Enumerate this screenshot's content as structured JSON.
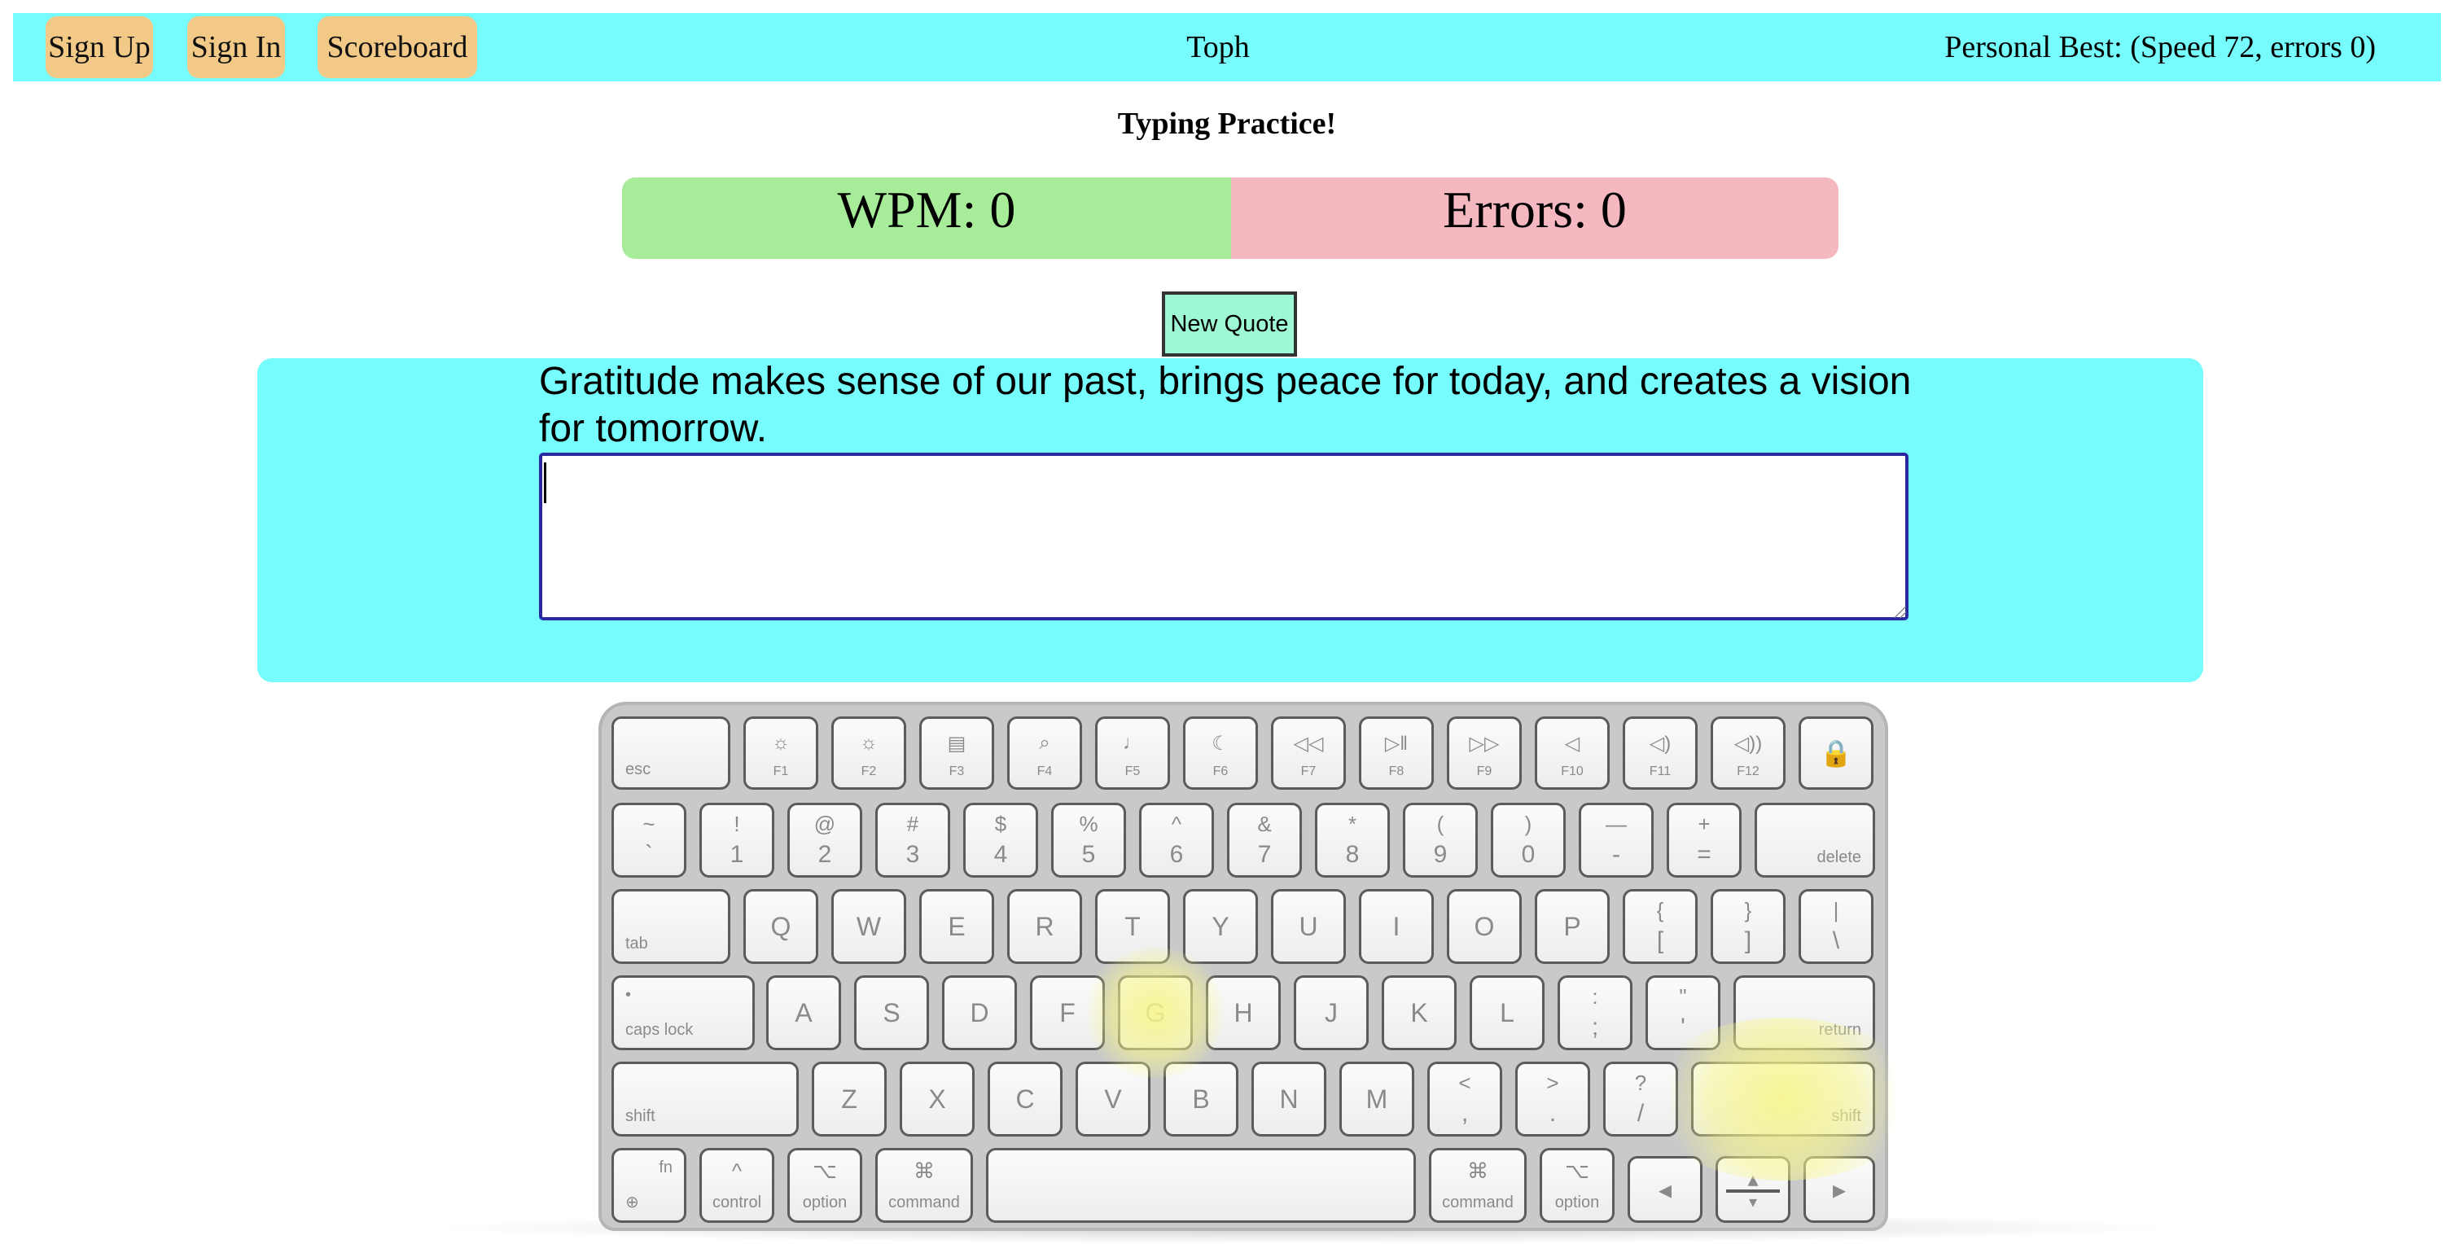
{
  "nav": {
    "signup_label": "Sign Up",
    "signin_label": "Sign In",
    "scoreboard_label": "Scoreboard",
    "brand": "Toph",
    "personal_best": "Personal Best: (Speed 72, errors 0)"
  },
  "main": {
    "title": "Typing Practice!",
    "wpm_text": "WPM: 0",
    "errors_text": "Errors: 0",
    "new_quote_label": "New Quote",
    "quote": "Gratitude makes sense of our past, brings peace for today, and creates a vision for tomorrow.",
    "input_value": ""
  },
  "colors": {
    "navbar": "#76fcfc",
    "nav_button": "#f2c987",
    "wpm_bg": "#a7ec98",
    "errors_bg": "#f5b8c0",
    "new_quote_bg": "#9ef7d5",
    "panel": "#76fcfc",
    "highlight": "#f6f68c"
  },
  "keyboard": {
    "highlighted_keys": [
      "G",
      "right shift"
    ],
    "fn_row": [
      {
        "icon": "☼",
        "label": "F1"
      },
      {
        "icon": "☼",
        "label": "F2"
      },
      {
        "icon": "▤",
        "label": "F3"
      },
      {
        "icon": "⌕",
        "label": "F4"
      },
      {
        "icon": "♩",
        "label": "F5"
      },
      {
        "icon": "☾",
        "label": "F6"
      },
      {
        "icon": "◁◁",
        "label": "F7"
      },
      {
        "icon": "▷‖",
        "label": "F8"
      },
      {
        "icon": "▷▷",
        "label": "F9"
      },
      {
        "icon": "◁",
        "label": "F10"
      },
      {
        "icon": "◁)",
        "label": "F11"
      },
      {
        "icon": "◁))",
        "label": "F12"
      }
    ],
    "esc": "esc",
    "lock_icon": "🔒",
    "number_row": [
      {
        "u": "~",
        "l": "`"
      },
      {
        "u": "!",
        "l": "1"
      },
      {
        "u": "@",
        "l": "2"
      },
      {
        "u": "#",
        "l": "3"
      },
      {
        "u": "$",
        "l": "4"
      },
      {
        "u": "%",
        "l": "5"
      },
      {
        "u": "^",
        "l": "6"
      },
      {
        "u": "&",
        "l": "7"
      },
      {
        "u": "*",
        "l": "8"
      },
      {
        "u": "(",
        "l": "9"
      },
      {
        "u": ")",
        "l": "0"
      },
      {
        "u": "—",
        "l": "-"
      },
      {
        "u": "+",
        "l": "="
      }
    ],
    "delete": "delete",
    "tab": "tab",
    "qwerty_row": [
      "Q",
      "W",
      "E",
      "R",
      "T",
      "Y",
      "U",
      "I",
      "O",
      "P"
    ],
    "bracket_keys": [
      {
        "u": "{",
        "l": "["
      },
      {
        "u": "}",
        "l": "]"
      },
      {
        "u": "|",
        "l": "\\"
      }
    ],
    "caps": "caps lock",
    "caps_dot": "•",
    "home_row": [
      "A",
      "S",
      "D",
      "F",
      "G",
      "H",
      "J",
      "K",
      "L"
    ],
    "home_punct": [
      {
        "u": ":",
        "l": ";"
      },
      {
        "u": "\"",
        "l": "'"
      }
    ],
    "return": "return",
    "shift": "shift",
    "bottom_letters": [
      "Z",
      "X",
      "C",
      "V",
      "B",
      "N",
      "M"
    ],
    "bottom_punct": [
      {
        "u": "<",
        "l": ","
      },
      {
        "u": ">",
        "l": "."
      },
      {
        "u": "?",
        "l": "/"
      }
    ],
    "fn": "fn",
    "globe": "⊕",
    "control": "control",
    "control_sym": "^",
    "option": "option",
    "option_sym": "⌥",
    "command": "command",
    "command_sym": "⌘",
    "arrow_left": "◂",
    "arrow_right": "▸",
    "arrow_up": "▴",
    "arrow_down": "▾"
  }
}
